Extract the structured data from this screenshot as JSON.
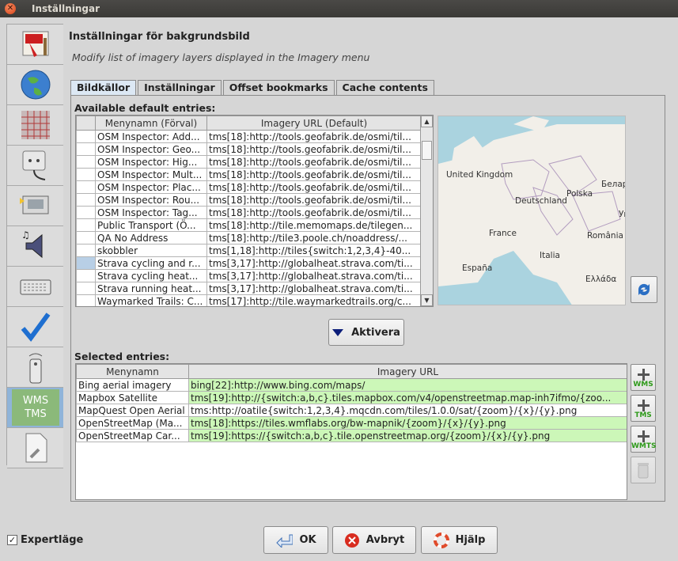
{
  "window": {
    "title": "Inställningar"
  },
  "sidebar": {
    "items": [
      "display",
      "map-projection",
      "grid",
      "connection",
      "plugins",
      "audio",
      "shortcuts",
      "validator",
      "remote-control",
      "wms-tms",
      "advanced"
    ],
    "selected_label": "WMS\nTMS"
  },
  "header": {
    "title": "Inställningar för bakgrundsbild",
    "subtitle": "Modify list of imagery layers displayed in the Imagery menu"
  },
  "tabs": [
    "Bildkällor",
    "Inställningar",
    "Offset bookmarks",
    "Cache contents"
  ],
  "available": {
    "label": "Available default entries:",
    "columns": [
      "Menynamn (Förval)",
      "Imagery URL (Default)"
    ],
    "rows": [
      {
        "name": "OSM Inspector: Add...",
        "url": "tms[18]:http://tools.geofabrik.de/osmi/til..."
      },
      {
        "name": "OSM Inspector: Geo...",
        "url": "tms[18]:http://tools.geofabrik.de/osmi/til..."
      },
      {
        "name": "OSM Inspector: Hig...",
        "url": "tms[18]:http://tools.geofabrik.de/osmi/til..."
      },
      {
        "name": "OSM Inspector: Mult...",
        "url": "tms[18]:http://tools.geofabrik.de/osmi/til..."
      },
      {
        "name": "OSM Inspector: Plac...",
        "url": "tms[18]:http://tools.geofabrik.de/osmi/til..."
      },
      {
        "name": "OSM Inspector: Rou...",
        "url": "tms[18]:http://tools.geofabrik.de/osmi/til..."
      },
      {
        "name": "OSM Inspector: Tag...",
        "url": "tms[18]:http://tools.geofabrik.de/osmi/til..."
      },
      {
        "name": "Public Transport (Ö...",
        "url": "tms[18]:http://tile.memomaps.de/tilegen..."
      },
      {
        "name": "QA No Address",
        "url": "tms[18]:http://tile3.poole.ch/noaddress/..."
      },
      {
        "name": "skobbler",
        "url": "tms[1,18]:http://tiles{switch:1,2,3,4}-40..."
      },
      {
        "name": "Strava cycling and r...",
        "url": "tms[3,17]:http://globalheat.strava.com/ti..."
      },
      {
        "name": "Strava cycling heat...",
        "url": "tms[3,17]:http://globalheat.strava.com/ti..."
      },
      {
        "name": "Strava running heat...",
        "url": "tms[3,17]:http://globalheat.strava.com/ti..."
      },
      {
        "name": "Waymarked Trails: C...",
        "url": "tms[17]:http://tile.waymarkedtrails.org/c..."
      }
    ],
    "selected_row": 10
  },
  "map": {
    "labels": [
      "United Kingdom",
      "Polska",
      "Deutschland",
      "Белару",
      "France",
      "Ук",
      "România",
      "Italia",
      "España",
      "Ελλάδα"
    ]
  },
  "activate_button": "Aktivera",
  "selected": {
    "label": "Selected entries:",
    "columns": [
      "Menynamn",
      "Imagery URL"
    ],
    "rows": [
      {
        "name": "Bing aerial imagery",
        "url": "bing[22]:http://www.bing.com/maps/",
        "valid": true
      },
      {
        "name": "Mapbox Satellite",
        "url": "tms[19]:http://{switch:a,b,c}.tiles.mapbox.com/v4/openstreetmap.map-inh7ifmo/{zoo...",
        "valid": true
      },
      {
        "name": "MapQuest Open Aerial",
        "url": "tms:http://oatile{switch:1,2,3,4}.mqcdn.com/tiles/1.0.0/sat/{zoom}/{x}/{y}.png",
        "valid": false
      },
      {
        "name": "OpenStreetMap (Ma...",
        "url": "tms[18]:https://tiles.wmflabs.org/bw-mapnik/{zoom}/{x}/{y}.png",
        "valid": true
      },
      {
        "name": "OpenStreetMap Car...",
        "url": "tms[19]:https://{switch:a,b,c}.tile.openstreetmap.org/{zoom}/{x}/{y}.png",
        "valid": true
      }
    ]
  },
  "side_buttons": [
    "WMS",
    "TMS",
    "WMTS"
  ],
  "footer": {
    "expert_label": "Expertläge",
    "ok": "OK",
    "cancel": "Avbryt",
    "help": "Hjälp"
  }
}
